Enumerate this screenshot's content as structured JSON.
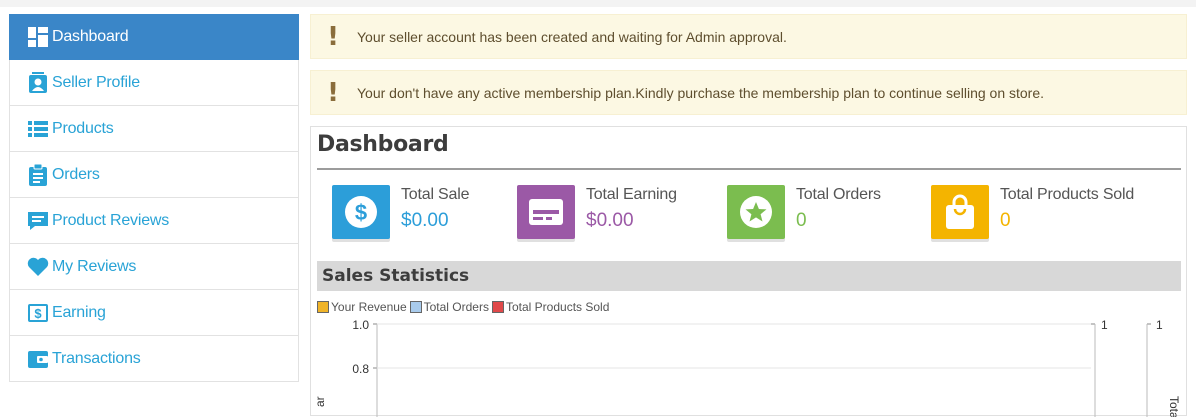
{
  "sidebar": {
    "items": [
      {
        "label": "Dashboard",
        "icon": "dashboard-icon",
        "active": true
      },
      {
        "label": "Seller Profile",
        "icon": "profile-icon"
      },
      {
        "label": "Products",
        "icon": "list-icon"
      },
      {
        "label": "Orders",
        "icon": "clipboard-icon"
      },
      {
        "label": "Product Reviews",
        "icon": "comment-icon"
      },
      {
        "label": "My Reviews",
        "icon": "heart-icon"
      },
      {
        "label": "Earning",
        "icon": "dollar-icon"
      },
      {
        "label": "Transactions",
        "icon": "wallet-icon"
      }
    ]
  },
  "alerts": [
    {
      "icon": "exclamation-icon",
      "text": "Your seller account has been created and waiting for Admin approval."
    },
    {
      "icon": "exclamation-icon",
      "text": "Your don't have any active membership plan.Kindly purchase the membership plan to continue selling on store."
    }
  ],
  "dashboard": {
    "title": "Dashboard",
    "stats": [
      {
        "label": "Total Sale",
        "value": "$0.00",
        "color": "#2c9ed9",
        "icon": "dollar-circle-icon"
      },
      {
        "label": "Total Earning",
        "value": "$0.00",
        "color": "#9b59a6",
        "icon": "credit-card-icon"
      },
      {
        "label": "Total Orders",
        "value": "0",
        "color": "#7bbd4f",
        "icon": "star-circle-icon"
      },
      {
        "label": "Total Products Sold",
        "value": "0",
        "color": "#f4b400",
        "icon": "shopping-bag-icon"
      }
    ],
    "sales_title": "Sales Statistics"
  },
  "chart_data": {
    "type": "line",
    "series": [
      {
        "name": "Your Revenue",
        "color": "#f0b429",
        "values": []
      },
      {
        "name": "Total Orders",
        "color": "#a9cbec",
        "values": []
      },
      {
        "name": "Total Products Sold",
        "color": "#e0494a",
        "values": []
      }
    ],
    "left_axis_ticks": [
      "1.0",
      "0.8"
    ],
    "right_axis_ticks": [
      "1",
      "1"
    ],
    "left_axis_label_fragment": "ar",
    "right_axis_label_fragments": [
      "Tc",
      "Total"
    ]
  }
}
